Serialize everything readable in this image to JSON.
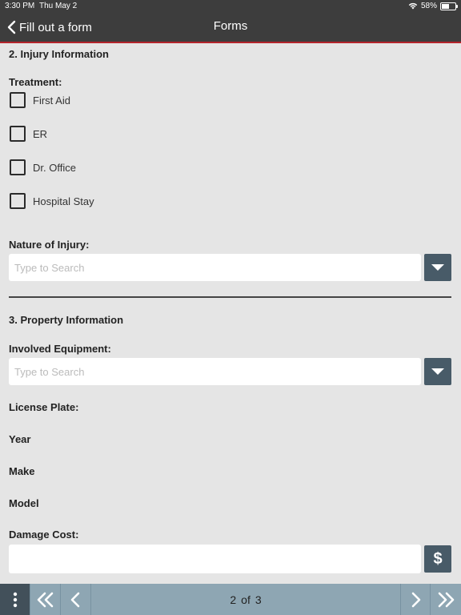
{
  "status_bar": {
    "time": "3:30 PM",
    "date": "Thu May 2",
    "battery": "58%"
  },
  "nav": {
    "back_label": "Fill out a form",
    "title": "Forms"
  },
  "injury": {
    "section_title": "2. Injury Information",
    "treatment_label": "Treatment:",
    "treatments": [
      {
        "label": "First Aid",
        "checked": false
      },
      {
        "label": "ER",
        "checked": false
      },
      {
        "label": "Dr. Office",
        "checked": false
      },
      {
        "label": "Hospital Stay",
        "checked": false
      }
    ],
    "nature_label": "Nature of Injury:",
    "nature_placeholder": "Type to Search"
  },
  "property": {
    "section_title": "3. Property Information",
    "equipment_label": "Involved Equipment:",
    "equipment_placeholder": "Type to Search",
    "license_label": "License Plate:",
    "year_label": "Year",
    "make_label": "Make",
    "model_label": "Model",
    "damage_label": "Damage Cost:",
    "damage_value": "",
    "currency_symbol": "$"
  },
  "pager": {
    "current": "2",
    "of_label": "of",
    "total": "3"
  },
  "colors": {
    "nav_bg": "#3d3d3d",
    "nav_accent": "#b3242b",
    "button_bg": "#485b68",
    "pager_bg": "#8ea6b3",
    "pager_dark": "#42505a"
  }
}
